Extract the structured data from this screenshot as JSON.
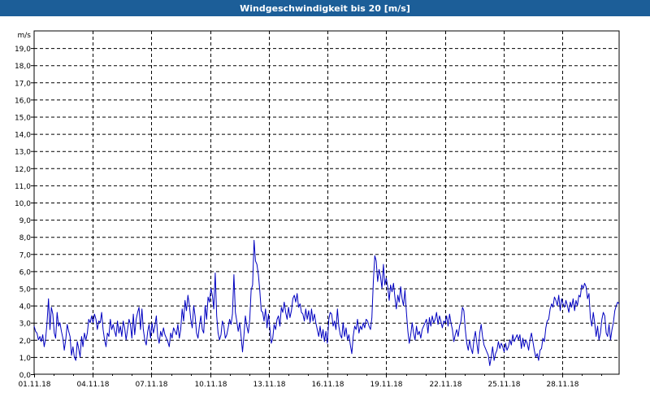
{
  "window": {
    "title": "Windgeschwindigkeit bis 20 [m/s]"
  },
  "colors": {
    "titlebar": "#1c5e98",
    "series": "#0000c0",
    "grid": "#000000"
  },
  "chart_data": {
    "type": "line",
    "ylabel": "m/s",
    "ylim": [
      0,
      20
    ],
    "xlim_days": [
      0,
      29.9
    ],
    "yticks": [
      "0,0",
      "1,0",
      "2,0",
      "3,0",
      "4,0",
      "5,0",
      "6,0",
      "7,0",
      "8,0",
      "9,0",
      "10,0",
      "11,0",
      "12,0",
      "13,0",
      "14,0",
      "15,0",
      "16,0",
      "17,0",
      "18,0",
      "19,0"
    ],
    "xticks": [
      "01.11.18",
      "04.11.18",
      "07.11.18",
      "10.11.18",
      "13.11.18",
      "16.11.18",
      "19.11.18",
      "22.11.18",
      "25.11.18",
      "28.11.18"
    ],
    "grid": true,
    "series": [
      {
        "values": [
          2.8,
          2.5,
          2.4,
          2.0,
          2.2,
          1.9,
          2.3,
          1.6,
          2.1,
          3.0,
          4.4,
          2.6,
          3.9,
          3.5,
          2.4,
          2.1,
          3.6,
          2.8,
          3.0,
          2.5,
          2.1,
          1.4,
          2.0,
          2.9,
          2.5,
          2.2,
          1.1,
          1.6,
          1.0,
          0.8,
          1.9,
          1.5,
          1.0,
          2.2,
          1.6,
          2.4,
          2.0,
          2.4,
          3.2,
          3.0,
          3.4,
          3.0,
          3.5,
          3.2,
          2.6,
          3.1,
          3.0,
          3.6,
          2.6,
          2.0,
          1.6,
          2.4,
          2.2,
          3.2,
          2.6,
          2.9,
          2.5,
          2.2,
          3.1,
          2.4,
          2.8,
          2.2,
          3.1,
          2.7,
          2.0,
          2.6,
          3.2,
          2.9,
          2.1,
          3.5,
          2.3,
          3.2,
          3.6,
          3.9,
          2.6,
          3.8,
          2.6,
          2.0,
          1.7,
          2.5,
          2.9,
          2.1,
          3.0,
          2.4,
          2.8,
          3.4,
          2.2,
          1.8,
          2.5,
          2.2,
          2.7,
          2.3,
          2.1,
          1.9,
          1.6,
          2.4,
          2.1,
          2.7,
          2.5,
          2.3,
          2.9,
          2.1,
          2.6,
          3.8,
          3.1,
          4.3,
          3.7,
          4.6,
          4.0,
          3.2,
          2.7,
          4.0,
          3.4,
          2.4,
          2.1,
          2.8,
          3.4,
          2.6,
          2.4,
          4.0,
          3.2,
          4.5,
          4.2,
          5.0,
          4.6,
          3.8,
          5.9,
          3.4,
          2.4,
          2.0,
          2.3,
          3.1,
          2.8,
          2.1,
          2.3,
          2.7,
          3.2,
          2.9,
          3.5,
          5.8,
          3.6,
          3.1,
          2.5,
          3.0,
          2.2,
          1.3,
          2.3,
          3.4,
          2.8,
          2.4,
          3.2,
          4.9,
          5.2,
          7.8,
          6.6,
          6.4,
          5.8,
          4.9,
          3.7,
          3.6,
          3.1,
          3.8,
          2.7,
          3.5,
          2.7,
          1.8,
          2.1,
          2.9,
          2.6,
          3.2,
          3.4,
          2.8,
          3.9,
          3.6,
          4.2,
          3.6,
          3.2,
          3.9,
          3.3,
          3.7,
          4.4,
          4.6,
          4.2,
          4.7,
          3.9,
          4.1,
          3.6,
          3.5,
          3.1,
          3.8,
          3.2,
          3.7,
          3.0,
          3.8,
          3.1,
          3.5,
          3.0,
          2.6,
          2.2,
          2.8,
          2.1,
          2.6,
          1.9,
          2.5,
          1.8,
          3.2,
          3.6,
          3.5,
          2.8,
          3.1,
          2.6,
          3.8,
          2.8,
          2.3,
          2.1,
          3.0,
          2.2,
          2.7,
          2.0,
          2.3,
          1.7,
          1.2,
          2.2,
          2.8,
          2.6,
          3.2,
          2.4,
          2.8,
          2.6,
          3.0,
          2.7,
          3.2,
          3.1,
          2.8,
          2.6,
          3.3,
          5.4,
          6.9,
          6.6,
          5.4,
          6.1,
          5.7,
          5.0,
          6.4,
          5.2,
          5.6,
          5.1,
          4.3,
          5.2,
          4.8,
          5.3,
          4.5,
          3.8,
          4.6,
          4.2,
          5.1,
          4.4,
          4.0,
          4.9,
          3.6,
          2.5,
          1.8,
          2.3,
          3.0,
          2.4,
          2.0,
          2.8,
          2.3,
          2.5,
          2.1,
          2.6,
          2.8,
          3.0,
          3.2,
          2.4,
          3.3,
          2.8,
          3.4,
          3.0,
          3.2,
          3.6,
          2.9,
          3.4,
          3.1,
          2.7,
          3.1,
          3.0,
          3.4,
          2.8,
          3.5,
          3.0,
          2.6,
          1.9,
          2.3,
          2.6,
          2.2,
          2.8,
          3.1,
          3.9,
          3.7,
          2.6,
          1.8,
          1.4,
          2.0,
          1.5,
          1.2,
          2.0,
          2.5,
          1.8,
          1.2,
          2.4,
          2.9,
          2.2,
          1.7,
          1.5,
          1.3,
          1.1,
          0.5,
          1.0,
          1.6,
          0.8,
          1.2,
          1.4,
          1.9,
          1.5,
          1.8,
          1.6,
          1.3,
          1.8,
          1.4,
          1.6,
          2.0,
          1.7,
          2.3,
          1.9,
          2.1,
          2.3,
          2.0,
          2.3,
          1.5,
          2.1,
          1.6,
          2.0,
          1.8,
          1.4,
          2.0,
          2.4,
          1.9,
          1.4,
          1.0,
          1.2,
          0.8,
          1.4,
          1.5,
          2.1,
          1.9,
          2.7,
          3.1,
          3.2,
          3.8,
          4.1,
          3.9,
          4.5,
          4.3,
          4.0,
          4.6,
          3.7,
          4.4,
          4.1,
          3.9,
          4.3,
          4.0,
          3.6,
          4.2,
          3.9,
          4.4,
          3.7,
          4.3,
          4.0,
          4.6,
          4.5,
          5.2,
          5.0,
          5.3,
          5.1,
          4.4,
          4.7,
          3.3,
          2.8,
          3.6,
          3.0,
          2.2,
          2.8,
          2.0,
          2.4,
          3.2,
          3.6,
          3.4,
          2.4,
          2.2,
          2.9,
          2.0,
          2.6,
          3.0,
          3.7,
          4.0,
          4.2,
          4.1
        ]
      }
    ]
  }
}
